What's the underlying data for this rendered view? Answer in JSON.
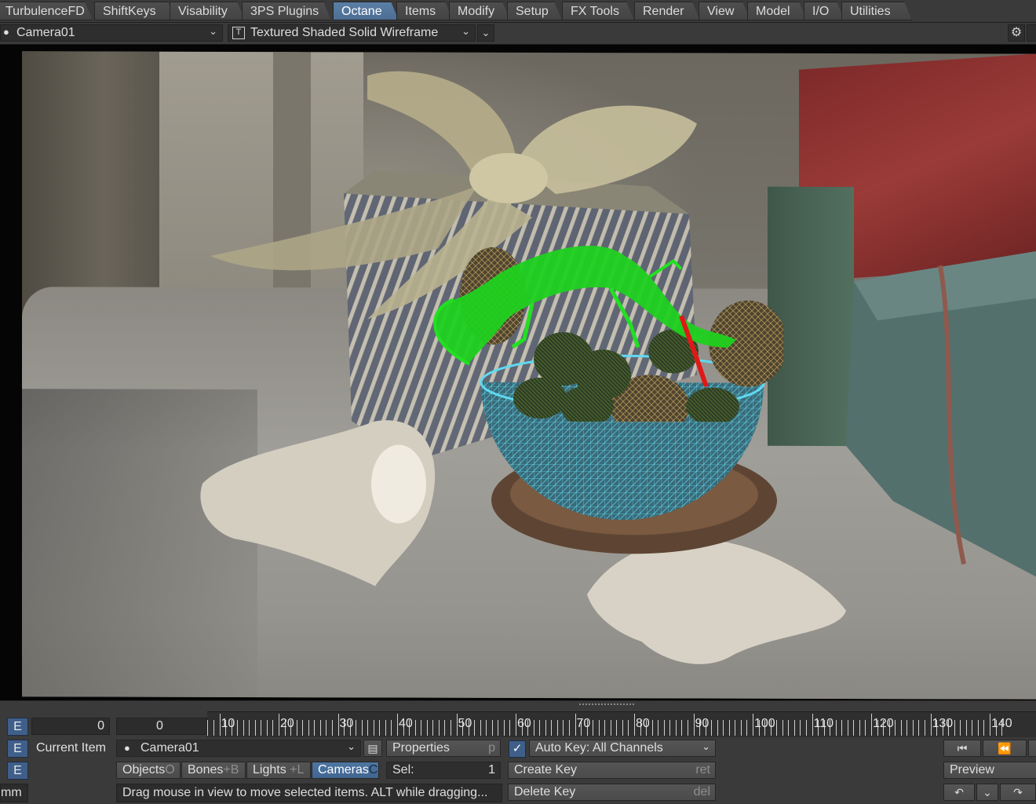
{
  "tabs": [
    {
      "label": "TurbulenceFD",
      "active": false
    },
    {
      "label": "ShiftKeys",
      "active": false
    },
    {
      "label": "Visability",
      "active": false
    },
    {
      "label": "3PS Plugins",
      "active": false
    },
    {
      "label": "Octane",
      "active": true
    },
    {
      "label": "Items",
      "active": false
    },
    {
      "label": "Modify",
      "active": false
    },
    {
      "label": "Setup",
      "active": false
    },
    {
      "label": "FX Tools",
      "active": false
    },
    {
      "label": "Render",
      "active": false
    },
    {
      "label": "View",
      "active": false
    },
    {
      "label": "Model",
      "active": false
    },
    {
      "label": "I/O",
      "active": false
    },
    {
      "label": "Utilities",
      "active": false
    }
  ],
  "viewport": {
    "camera_select": "Camera01",
    "render_mode": "Textured Shaded Solid Wireframe",
    "settings_icon": "gear-icon",
    "colors": {
      "lizard_wire": "#22e022",
      "bowl_wire": "#5fd9f0",
      "rock_wire": "#d9b768"
    }
  },
  "timeline": {
    "current_frame": "0",
    "frame_start_value": "0",
    "tick_labels": [
      "0",
      "10",
      "20",
      "30",
      "40",
      "50",
      "60",
      "70",
      "80",
      "90",
      "100",
      "110",
      "120",
      "130",
      "140"
    ]
  },
  "controls": {
    "e_label": "E",
    "current_item_label": "Current Item",
    "current_item_value": "Camera01",
    "properties_label": "Properties",
    "properties_hint": "p",
    "auto_key_label": "Auto Key: All Channels",
    "auto_key_checked": true,
    "objects_label": "Objects",
    "objects_hint": "O",
    "bones_label": "Bones",
    "bones_hint": "+B",
    "lights_label": "Lights",
    "lights_hint": "+L",
    "cameras_label": "Cameras",
    "cameras_hint": "C",
    "sel_label": "Sel:",
    "sel_value": "1",
    "create_key_label": "Create Key",
    "create_key_hint": "ret",
    "delete_key_label": "Delete Key",
    "delete_key_hint": "del",
    "preview_label": "Preview",
    "status_message": "Drag mouse in view to move selected items. ALT while dragging...",
    "units": "mm"
  }
}
